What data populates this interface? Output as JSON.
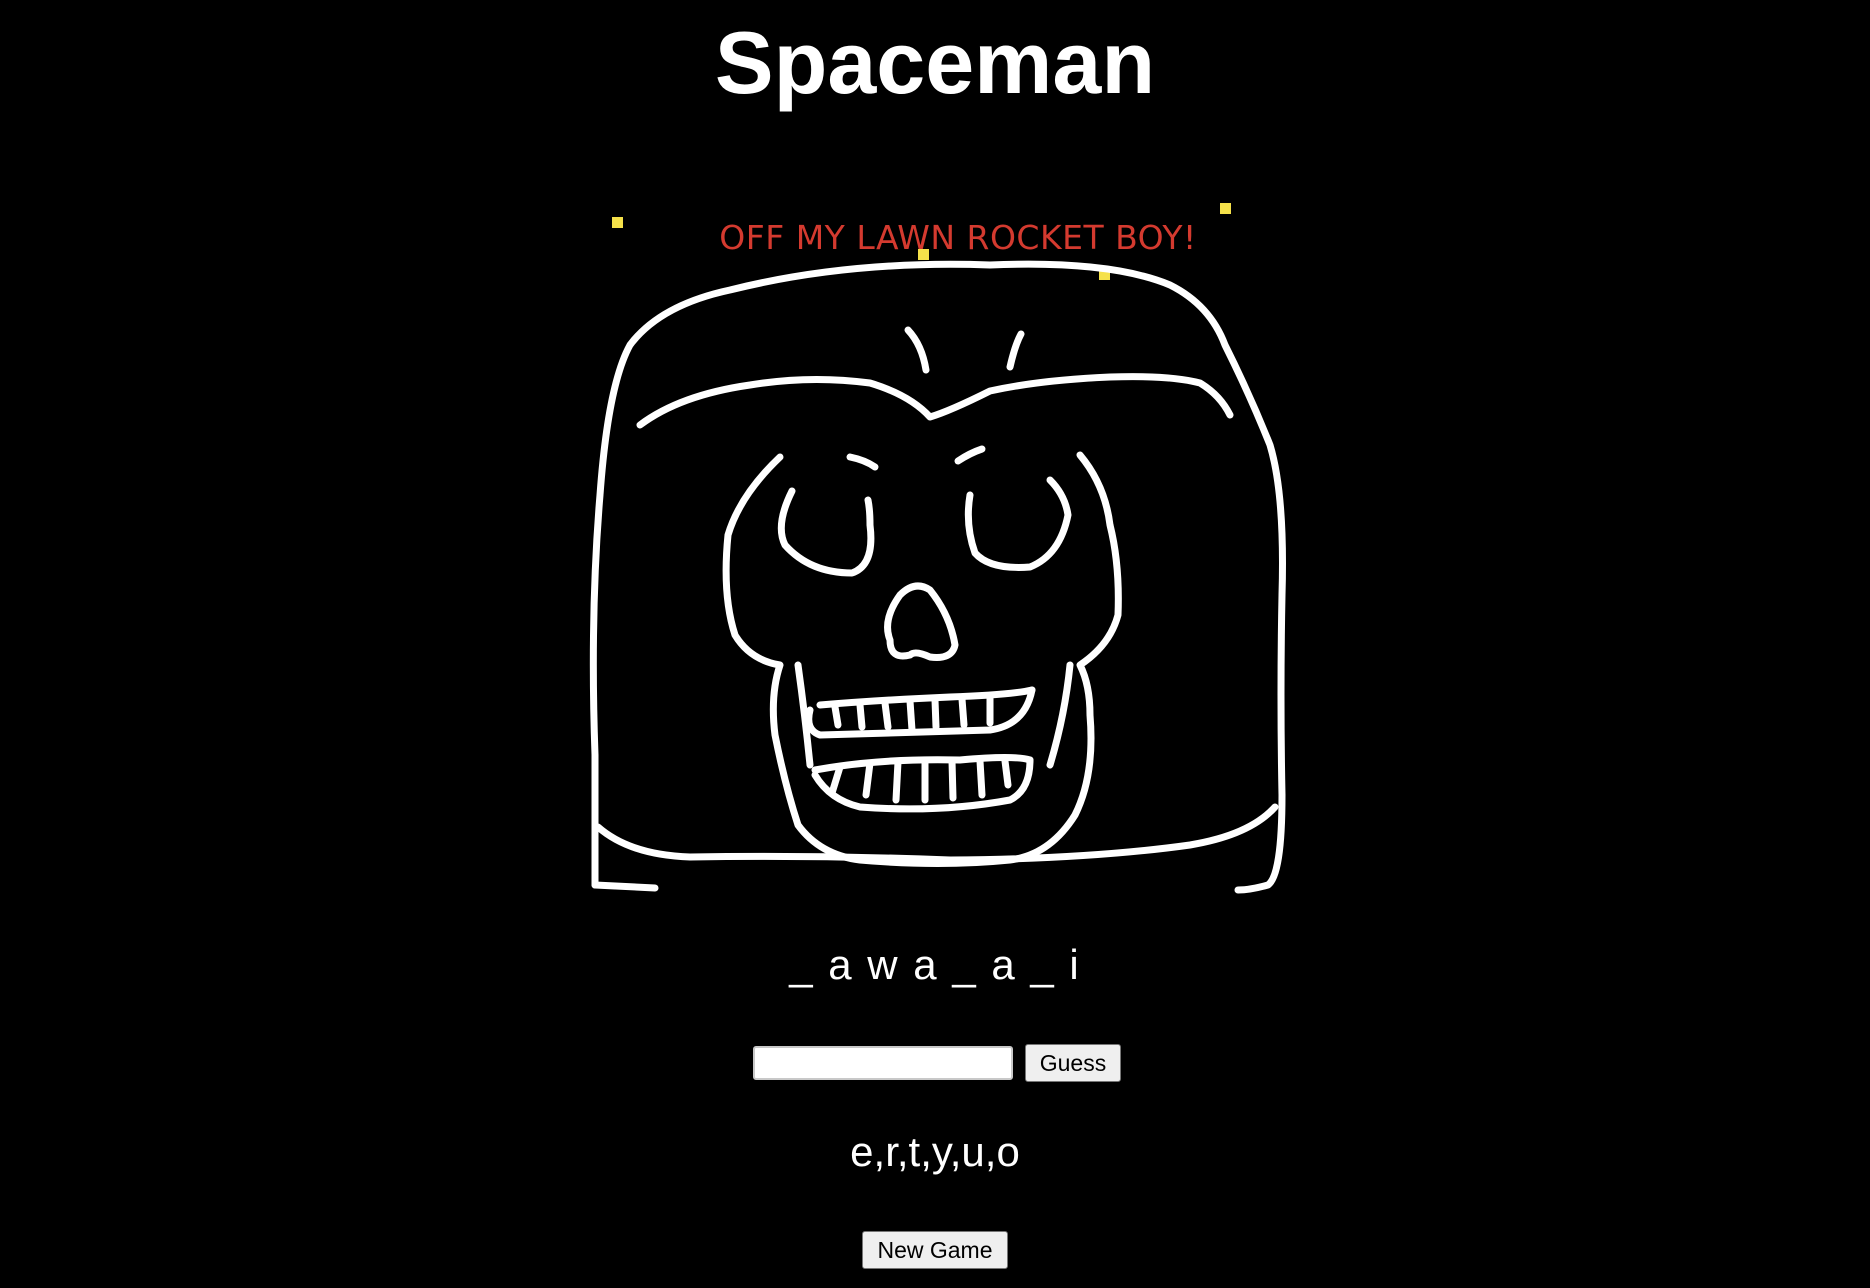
{
  "app": {
    "title": "Spaceman"
  },
  "scene": {
    "taunt": "OFF MY LAWN ROCKET BOY!",
    "taunt_color": "#d43a2f",
    "star_color": "#f5e14a",
    "drawing_color": "#ffffff"
  },
  "word_display": "_ a w a _ a _ i",
  "guess_form": {
    "input_value": "",
    "input_placeholder": "",
    "guess_label": "Guess"
  },
  "guessed_letters": "e,r,t,y,u,o",
  "controls": {
    "new_game_label": "New Game"
  }
}
